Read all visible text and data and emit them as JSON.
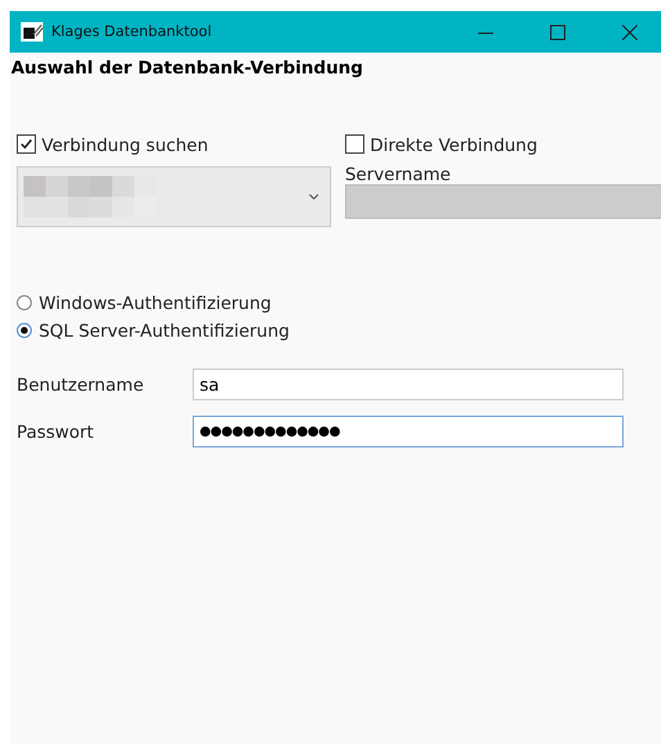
{
  "window": {
    "title": "Klages Datenbanktool"
  },
  "heading": "Auswahl der Datenbank-Verbindung",
  "options": [
    {
      "label": "Verbindung suchen",
      "checked": true
    },
    {
      "label": "Direkte Verbindung",
      "checked": false
    }
  ],
  "servername": {
    "label": "Servername",
    "disabled": true
  },
  "auth": [
    {
      "label": "Windows-Authentifizierung",
      "selected": false
    },
    {
      "label": "SQL Server-Authentifizierung",
      "selected": true
    }
  ],
  "fields": [
    {
      "label": "Benutzername",
      "kind": "text",
      "value": "sa",
      "focused": false
    },
    {
      "label": "Passwort",
      "kind": "password",
      "value": "●●●●●●●●●●●●●",
      "focused": true
    }
  ]
}
